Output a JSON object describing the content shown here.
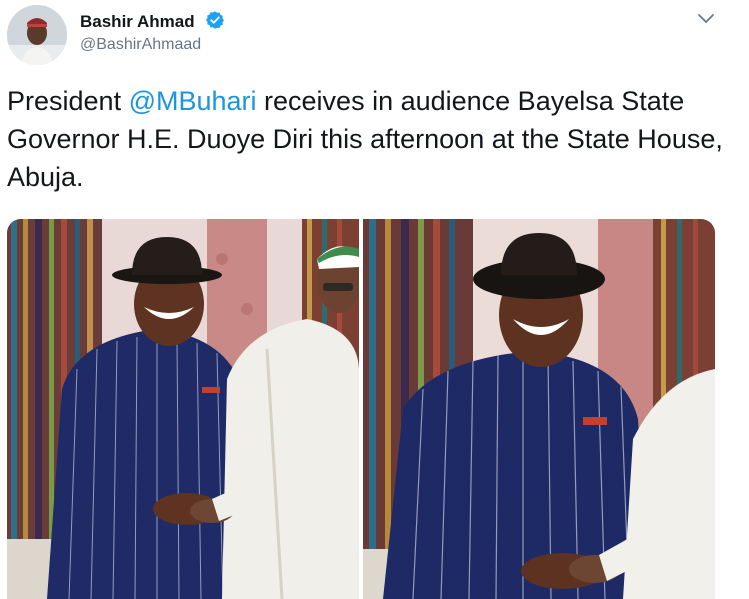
{
  "author": {
    "name": "Bashir Ahmad",
    "handle": "@BashirAhmaad",
    "verified": true
  },
  "tweet": {
    "text_before": "President ",
    "mention": "@MBuhari",
    "text_after": " receives in audience Bayelsa State Governor H.E. Duoye Diri this afternoon at the State House, Abuja."
  },
  "icons": {
    "verified": "verified-badge-icon",
    "menu": "chevron-down-icon"
  },
  "colors": {
    "link": "#1b95e0",
    "verified": "#1da1f2",
    "secondary_text": "#657786"
  },
  "media": {
    "count": 2,
    "photos": [
      "photo-handshake-wide",
      "photo-handshake-closeup"
    ]
  }
}
